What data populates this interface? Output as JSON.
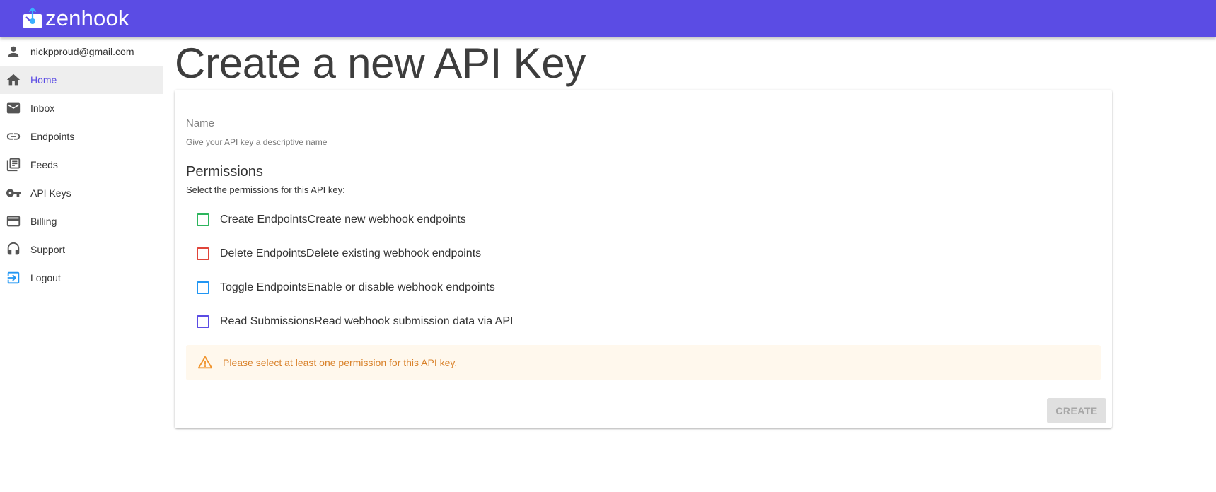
{
  "app": {
    "brand_name": "zenhook",
    "brand_color": "#5b4ce4"
  },
  "sidebar": {
    "user_email": "nickpproud@gmail.com",
    "items": [
      {
        "label": "Home",
        "icon": "home-icon",
        "active": true
      },
      {
        "label": "Inbox",
        "icon": "mail-icon",
        "active": false
      },
      {
        "label": "Endpoints",
        "icon": "link-icon",
        "active": false
      },
      {
        "label": "Feeds",
        "icon": "feeds-icon",
        "active": false
      },
      {
        "label": "API Keys",
        "icon": "key-icon",
        "active": false
      },
      {
        "label": "Billing",
        "icon": "credit-card-icon",
        "active": false
      },
      {
        "label": "Support",
        "icon": "headset-icon",
        "active": false
      },
      {
        "label": "Logout",
        "icon": "logout-icon",
        "active": false
      }
    ]
  },
  "main": {
    "title": "Create a new API Key",
    "name_field": {
      "placeholder": "Name",
      "value": "",
      "hint": "Give your API key a descriptive name"
    },
    "permissions": {
      "heading": "Permissions",
      "description": "Select the permissions for this API key:",
      "options": [
        {
          "label": "Create EndpointsCreate new webhook endpoints",
          "checked": false,
          "color": "#2db55d"
        },
        {
          "label": "Delete EndpointsDelete existing webhook endpoints",
          "checked": false,
          "color": "#e0453a"
        },
        {
          "label": "Toggle EndpointsEnable or disable webhook endpoints",
          "checked": false,
          "color": "#2196f3"
        },
        {
          "label": "Read SubmissionsRead webhook submission data via API",
          "checked": false,
          "color": "#5b4ce4"
        }
      ]
    },
    "alert": {
      "icon": "warning-icon",
      "text": "Please select at least one permission for this API key."
    },
    "create_button": {
      "label": "CREATE",
      "disabled": true
    }
  }
}
